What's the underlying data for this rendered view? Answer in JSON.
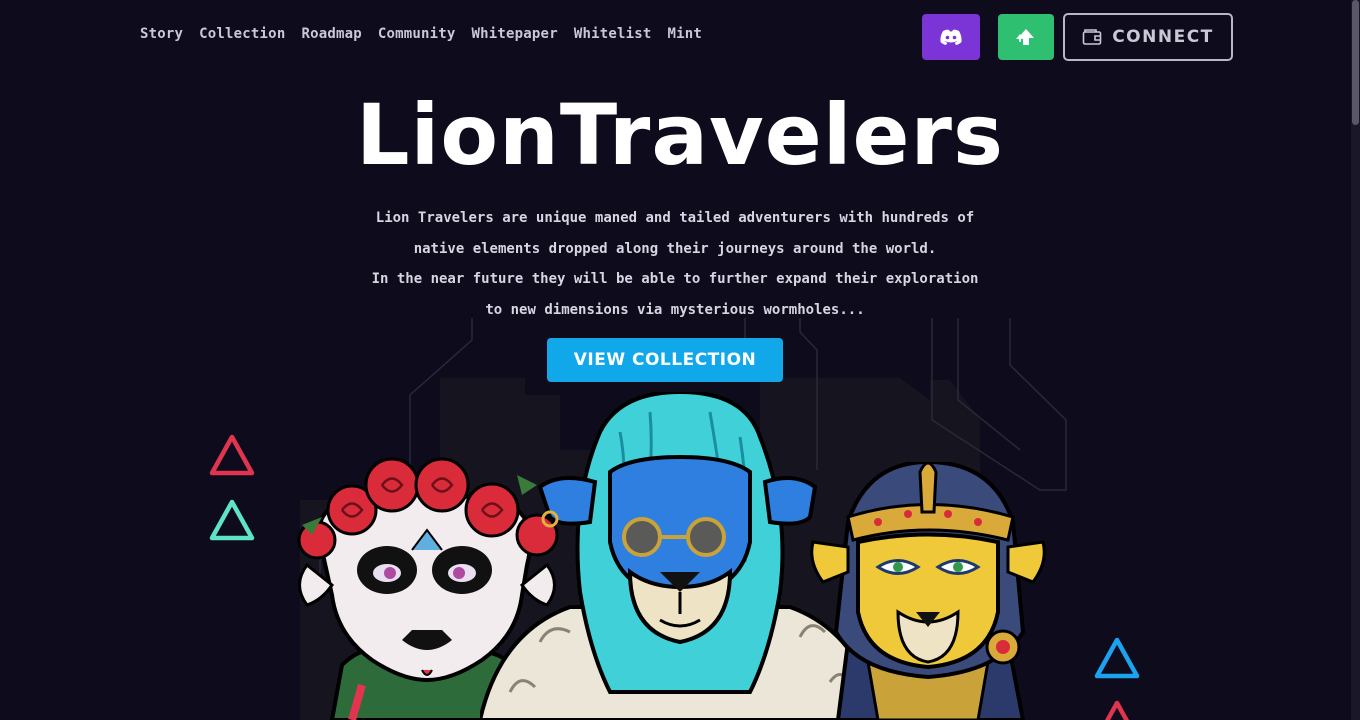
{
  "nav": {
    "items": [
      "Story",
      "Collection",
      "Roadmap",
      "Community",
      "Whitepaper",
      "Whitelist",
      "Mint"
    ]
  },
  "header": {
    "discord_icon": "discord-icon",
    "green_icon": "opensea-arrow-icon",
    "connect_label": "CONNECT",
    "wallet_icon": "wallet-icon"
  },
  "hero": {
    "title": "LionTravelers",
    "description_line1": "Lion Travelers are unique maned and tailed adventurers with hundreds of native elements dropped along their journeys around the world.",
    "description_line2": "In the near future they will be able to further expand their exploration to new dimensions via mysterious wormholes...",
    "cta_label": "VIEW COLLECTION"
  },
  "colors": {
    "background": "#0d0b1c",
    "discord": "#7b35d6",
    "green": "#2fbf71",
    "cta": "#11a8ea",
    "triangle_red": "#e0344f",
    "triangle_teal": "#5fe3c6",
    "triangle_blue": "#1ba3f0"
  }
}
